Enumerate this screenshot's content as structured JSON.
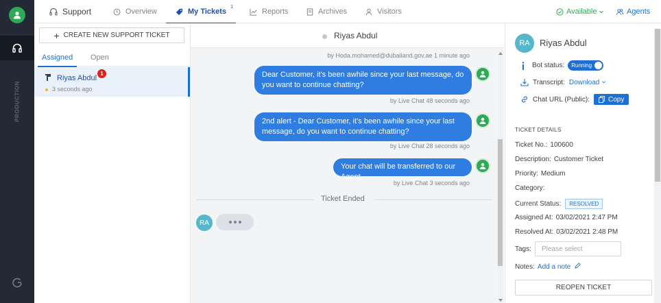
{
  "topbar": {
    "tabs": [
      {
        "label": "Support",
        "icon": "headset-icon"
      },
      {
        "label": "Overview",
        "icon": "clock-icon"
      },
      {
        "label": "My Tickets",
        "icon": "tag-icon",
        "count": "1"
      },
      {
        "label": "Reports",
        "icon": "chart-icon"
      },
      {
        "label": "Archives",
        "icon": "document-icon"
      },
      {
        "label": "Visitors",
        "icon": "user-icon"
      }
    ],
    "status": "Available",
    "agents": "Agents"
  },
  "sidebar": {
    "environment": "PRODUCTION"
  },
  "ticket_list": {
    "create_label": "CREATE NEW SUPPORT TICKET",
    "tabs": [
      "Assigned",
      "Open"
    ],
    "tickets": [
      {
        "name": "Riyas Abdul",
        "unread": "1",
        "time": "3 seconds ago"
      }
    ]
  },
  "chat": {
    "contact_name": "Riyas Abdul",
    "messages": [
      {
        "meta": "by Hoda.mohamed@dubailand.gov.ae  1 minute ago"
      },
      {
        "text": "Dear Customer, it's been awhile since your last message, do you want to continue chatting?",
        "meta": "by Live Chat  48 seconds ago"
      },
      {
        "text": "2nd alert - Dear Customer, it's been awhile since your last message, do you want to continue chatting?",
        "meta": "by Live Chat  28 seconds ago"
      },
      {
        "text": "Your chat will be transferred to our Agent",
        "meta": "by Live Chat  3 seconds ago"
      }
    ],
    "ended_label": "Ticket Ended",
    "visitor_initials": "RA"
  },
  "details": {
    "initials": "RA",
    "name": "Riyas Abdul",
    "bot_status_label": "Bot status:",
    "bot_status_value": "Running",
    "transcript_label": "Transcript:",
    "transcript_action": "Download",
    "chat_url_label": "Chat URL (Public):",
    "copy_label": "Copy",
    "section_title": "TICKET DETAILS",
    "fields": {
      "ticket_no_label": "Ticket No.:",
      "ticket_no": "100600",
      "description_label": "Description:",
      "description": "Customer Ticket",
      "priority_label": "Priority:",
      "priority": "Medium",
      "category_label": "Category:",
      "status_label": "Current Status:",
      "status": "RESOLVED",
      "assigned_label": "Assigned At:",
      "assigned": "03/02/2021 2:47 PM",
      "resolved_label": "Resolved At:",
      "resolved": "03/02/2021 2:48 PM"
    },
    "tags_label": "Tags:",
    "tags_placeholder": "Please select",
    "notes_label": "Notes:",
    "add_note": "Add a note",
    "reopen_label": "REOPEN TICKET"
  },
  "colors": {
    "accent": "#1f6fd1",
    "bubble": "#2f7de1",
    "available": "#2eaa57",
    "rail": "#232a36"
  }
}
